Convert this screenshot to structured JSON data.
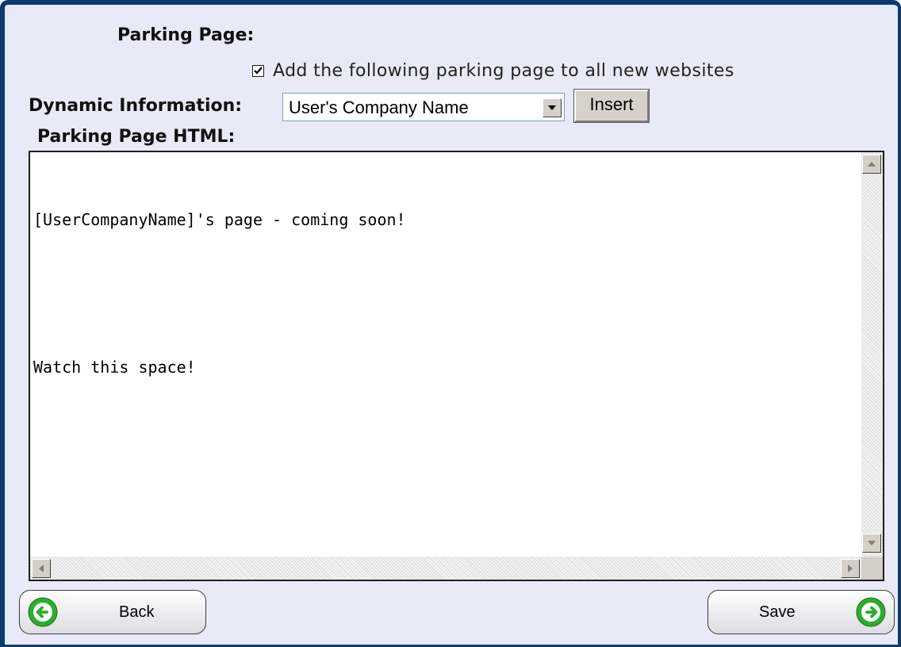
{
  "section": {
    "parking_page_label": "Parking Page:",
    "checkbox": {
      "checked": true,
      "label": "Add the following parking page to all new websites"
    },
    "dynamic_information": {
      "label": "Dynamic Information:",
      "selected": "User's Company Name",
      "insert_label": "Insert"
    },
    "html_editor": {
      "label": "Parking Page HTML:",
      "lines": [
        "[UserCompanyName]'s page - coming soon!",
        "",
        "Watch this space!"
      ]
    }
  },
  "footer": {
    "back_label": "Back",
    "save_label": "Save"
  },
  "colors": {
    "background": "#e9e9f7",
    "frame_border": "#0c3b6e",
    "nav_icon_green": "#2eac2b"
  }
}
